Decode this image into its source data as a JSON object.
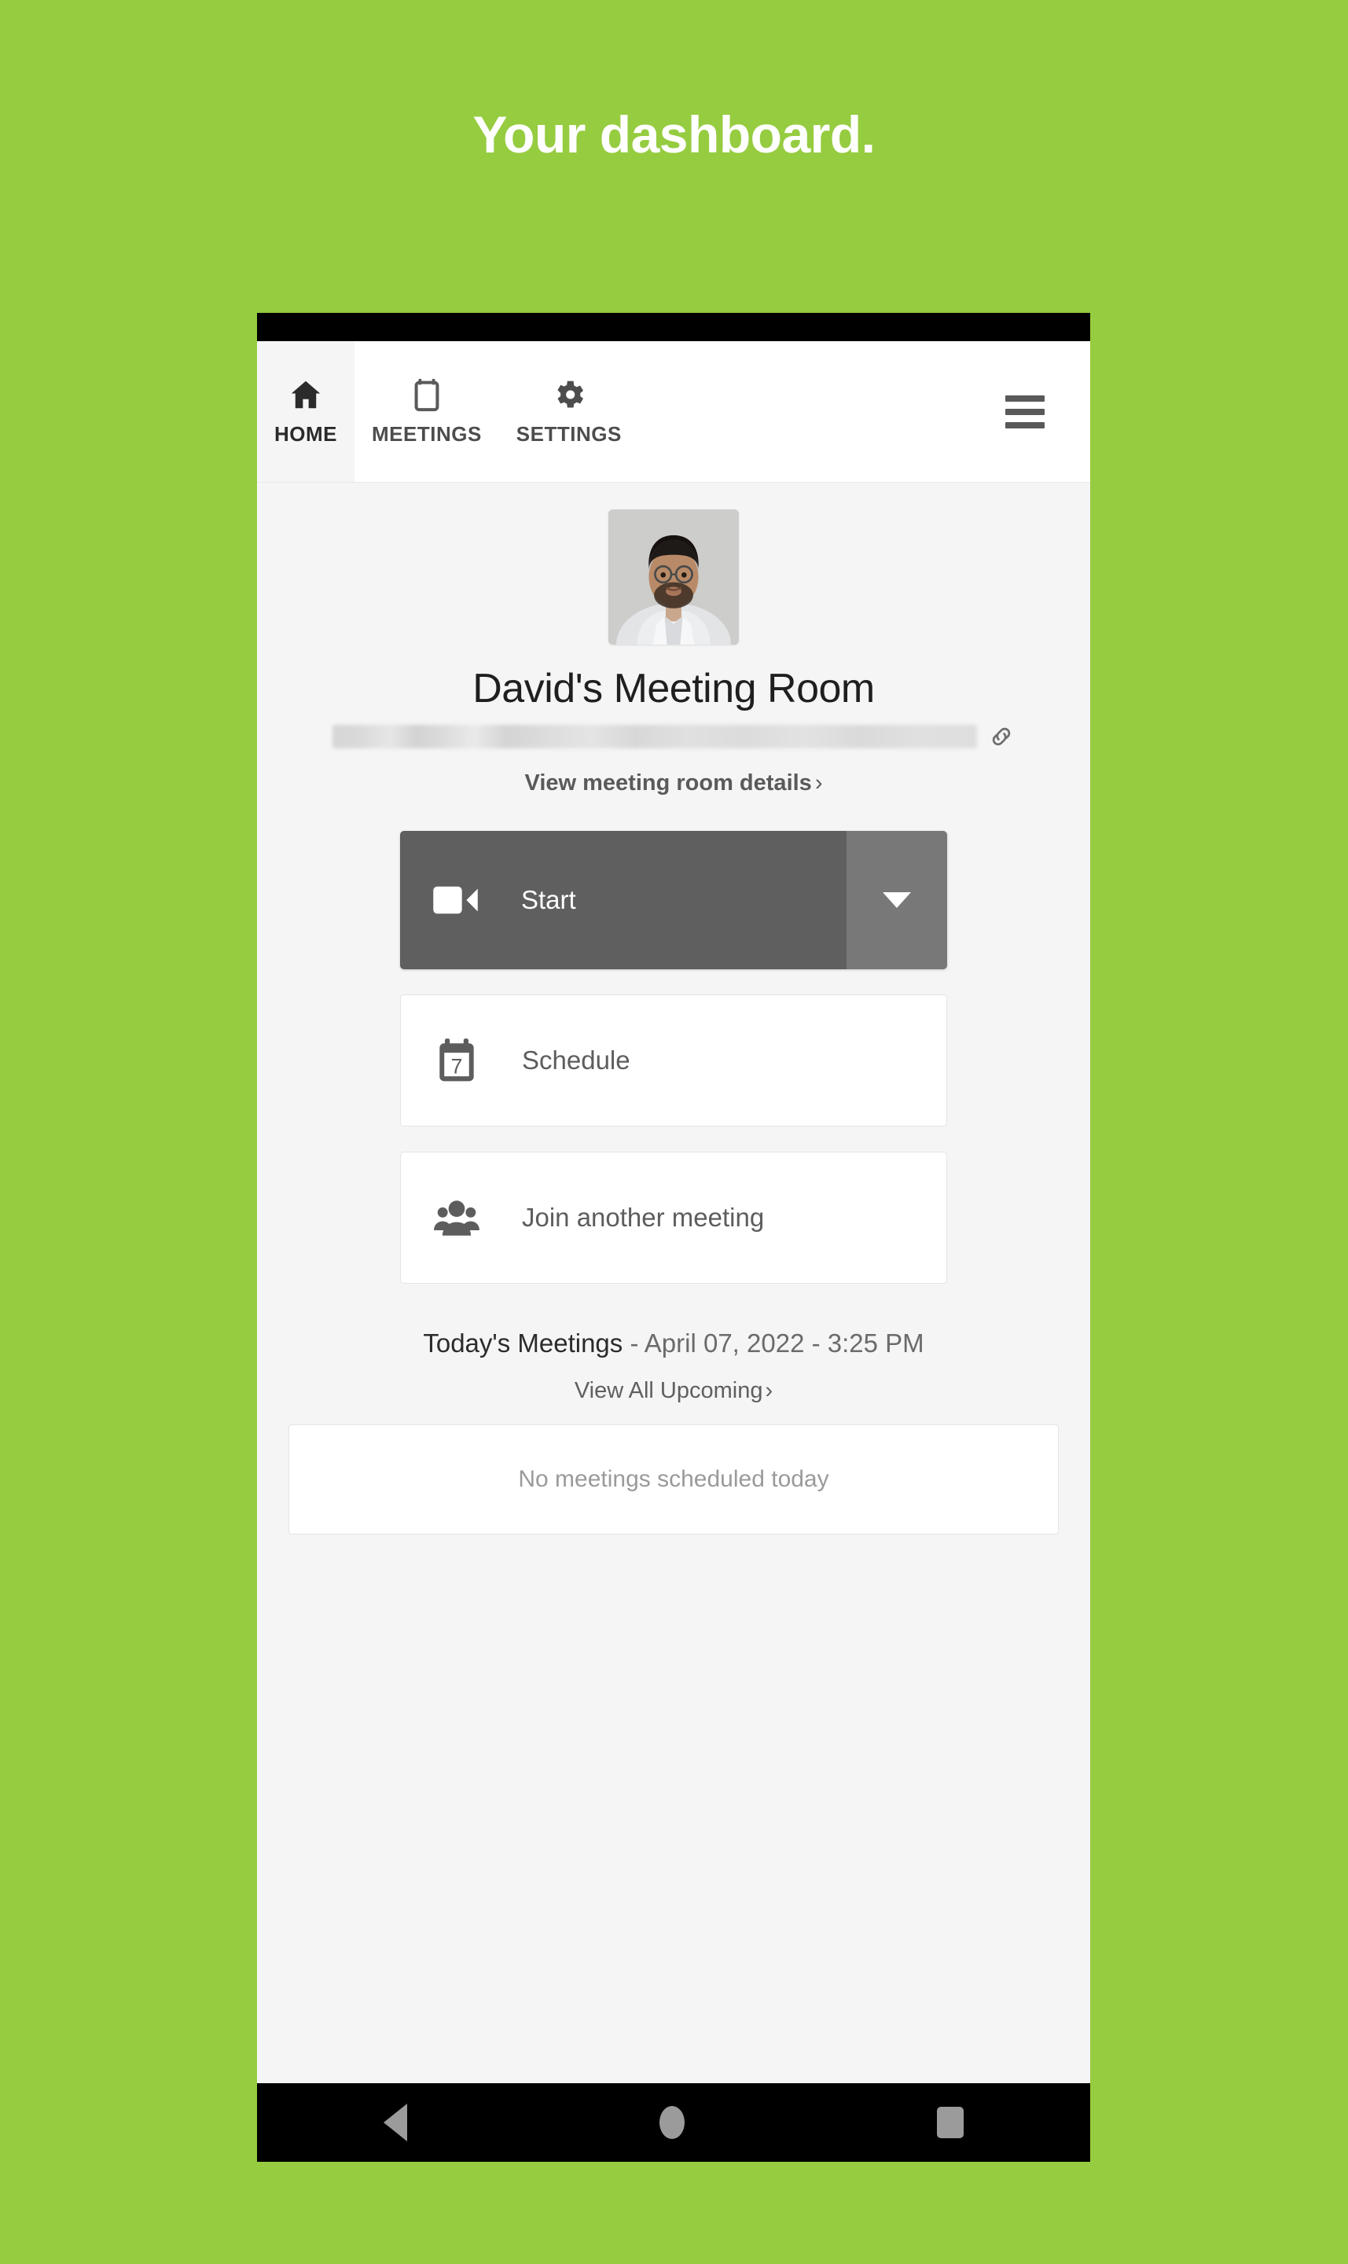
{
  "headline": "Your dashboard.",
  "colors": {
    "background_green": "#96cc40",
    "app_background": "#f5f5f5",
    "start_button": "#5f5f5f",
    "start_caret": "#787878"
  },
  "topnav": {
    "tabs": [
      {
        "label": "HOME",
        "icon": "home-icon",
        "active": true
      },
      {
        "label": "MEETINGS",
        "icon": "calendar-icon",
        "active": false
      },
      {
        "label": "SETTINGS",
        "icon": "gear-icon",
        "active": false
      }
    ],
    "menu_icon": "hamburger-icon"
  },
  "profile": {
    "avatar": "user-photo",
    "room_name": "David's Meeting Room",
    "room_url": "",
    "link_icon": "link-icon",
    "details_link": "View meeting room details",
    "details_chevron": "›"
  },
  "actions": {
    "start": {
      "label": "Start",
      "icon": "video-camera-icon",
      "dropdown_icon": "caret-down-icon"
    },
    "schedule": {
      "label": "Schedule",
      "icon": "calendar-7-icon",
      "day": "7"
    },
    "join": {
      "label": "Join another meeting",
      "icon": "people-group-icon"
    }
  },
  "today": {
    "heading": "Today's Meetings",
    "date_time": " - April 07, 2022 - 3:25 PM",
    "view_all": "View All Upcoming",
    "view_all_chevron": "›",
    "empty_message": "No meetings scheduled today"
  },
  "android_nav": {
    "back": "back-triangle-icon",
    "home": "home-circle-icon",
    "recents": "recents-square-icon"
  }
}
